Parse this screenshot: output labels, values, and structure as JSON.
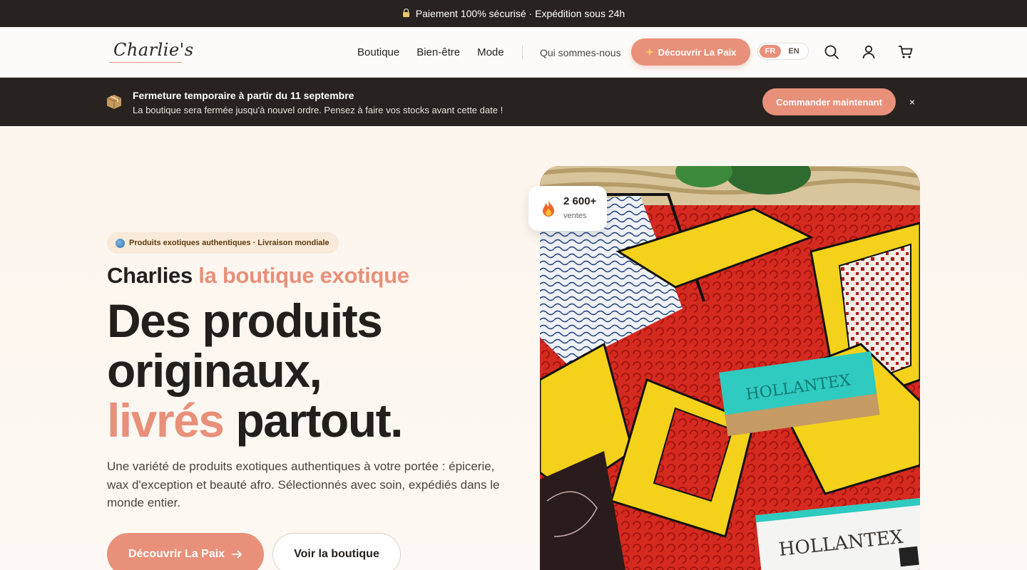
{
  "topbar": {
    "text": "Paiement 100% sécurisé · Expédition sous 24h"
  },
  "header": {
    "logo": "Charlie's",
    "nav": [
      "Boutique",
      "Bien-être",
      "Mode"
    ],
    "about": "Qui sommes-nous",
    "cta": "Découvrir La Paix",
    "lang": {
      "active": "FR",
      "other": "EN"
    }
  },
  "notice": {
    "title": "Fermeture temporaire à partir du 11 septembre",
    "text": "La boutique sera fermée jusqu'à nouvel ordre. Pensez à faire vos stocks avant cette date !",
    "button": "Commander maintenant",
    "close": "×"
  },
  "hero": {
    "badge": "Produits exotiques authentiques · Livraison mondiale",
    "subtitle_plain": "Charlies",
    "subtitle_accent": "la boutique exotique",
    "title_line1": "Des produits",
    "title_line2": "originaux,",
    "title_line3_accent": "livrés",
    "title_line3_rest": "partout.",
    "description": "Une variété de produits exotiques authentiques à votre portée : épicerie, wax d'exception et beauté afro. Sélectionnés avec soin, expédiés dans le monde entier.",
    "primary_button": "Découvrir La Paix",
    "secondary_button": "Voir la boutique"
  },
  "stat": {
    "value": "2 600+",
    "label": "ventes"
  },
  "photo": {
    "label1": "HOLLANTEX",
    "label2": "HOLLANTEX"
  },
  "colors": {
    "accent": "#e8907a",
    "dark": "#282320",
    "background": "#fdf8f3"
  }
}
